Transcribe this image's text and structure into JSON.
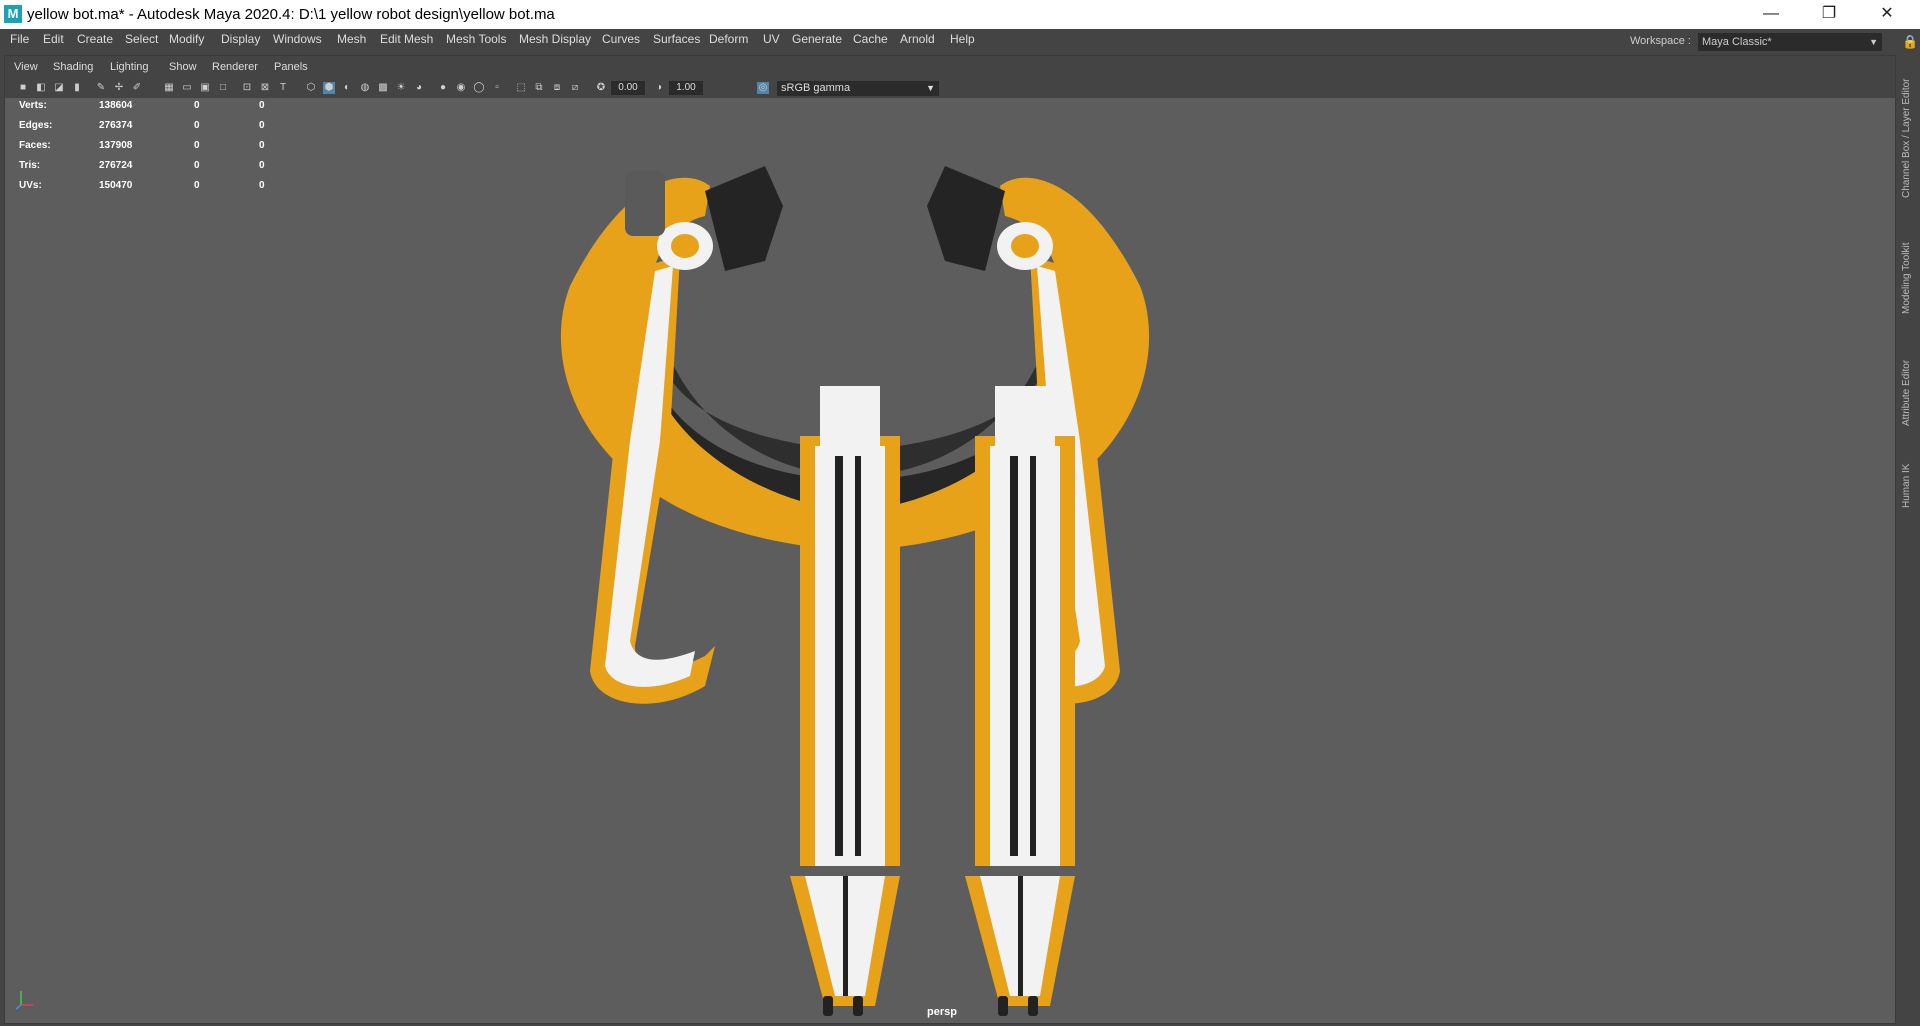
{
  "window": {
    "title": "yellow bot.ma* - Autodesk Maya 2020.4: D:\\1 yellow robot design\\yellow bot.ma",
    "logo_letter": "M",
    "controls": [
      "—",
      "❐",
      "✕"
    ]
  },
  "menu": [
    "File",
    "Edit",
    "Create",
    "Select",
    "Modify",
    "Display",
    "Windows",
    "Mesh",
    "Edit Mesh",
    "Mesh Tools",
    "Mesh Display",
    "Curves",
    "Surfaces",
    "Deform",
    "UV",
    "Generate",
    "Cache",
    "Arnold",
    "Help"
  ],
  "workspace": {
    "label": "Workspace :",
    "value": "Maya Classic*"
  },
  "side_tabs": [
    "Channel Box / Layer Editor",
    "Modeling Toolkit",
    "Attribute Editor",
    "Human IK"
  ],
  "panel_menu": [
    "View",
    "Shading",
    "Lighting",
    "Show",
    "Renderer",
    "Panels"
  ],
  "toolbar": {
    "exposure": "0.00",
    "gamma": "1.00",
    "color_space": "sRGB gamma"
  },
  "hud": [
    {
      "label": "Verts:",
      "total": "138604",
      "sel": "0",
      "tris": "0"
    },
    {
      "label": "Edges:",
      "total": "276374",
      "sel": "0",
      "tris": "0"
    },
    {
      "label": "Faces:",
      "total": "137908",
      "sel": "0",
      "tris": "0"
    },
    {
      "label": "Tris:",
      "total": "276724",
      "sel": "0",
      "tris": "0"
    },
    {
      "label": "UVs:",
      "total": "150470",
      "sel": "0",
      "tris": "0"
    }
  ],
  "camera": "persp",
  "colors": {
    "yellow": "#e8a21a",
    "white": "#f2f2f2",
    "dark": "#2a2a2a",
    "viewport_bg": "#5d5d5d"
  }
}
